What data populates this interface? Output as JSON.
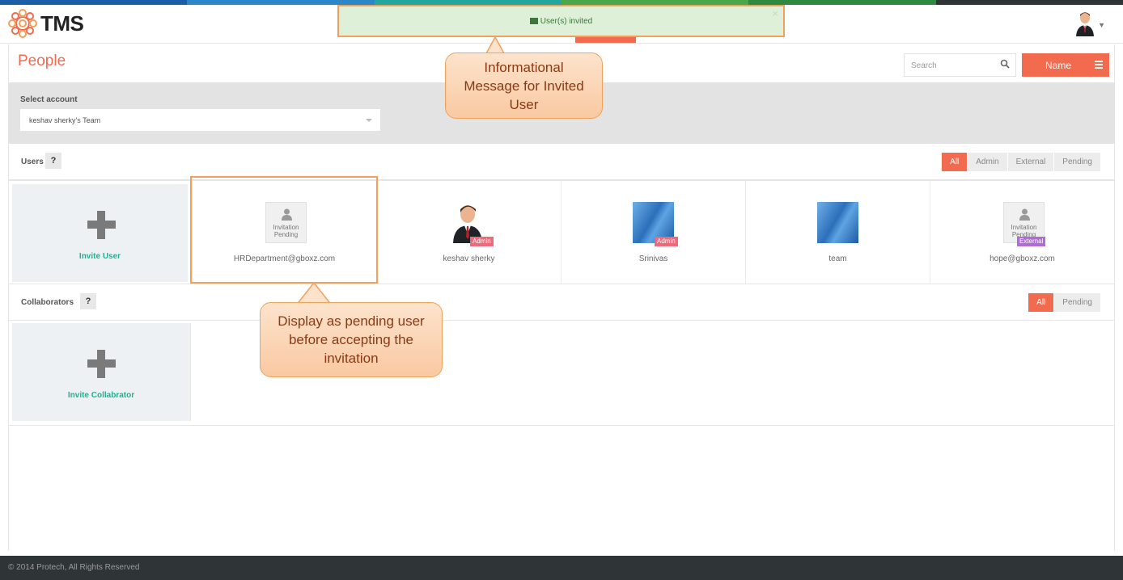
{
  "brand": {
    "logo_text": "TMS",
    "stripe_colors": [
      "#1b5fa8",
      "#2c87c9",
      "#24a6a0",
      "#4aa84a",
      "#f2a22e",
      "#2f3537"
    ]
  },
  "alert": {
    "message": "User(s) invited",
    "close_label": "×",
    "icon": "envelope-icon",
    "color": "#3c763d"
  },
  "page": {
    "title": "People",
    "search_placeholder": "Search",
    "sort_button_label": "Name"
  },
  "account": {
    "label": "Select account",
    "selected": "keshav sherky's Team"
  },
  "users": {
    "label": "Users",
    "help": "?",
    "filters": [
      "All",
      "Admin",
      "External",
      "Pending"
    ],
    "active_filter": "All",
    "invite_label": "Invite User",
    "cards": [
      {
        "name": "HRDepartment@gboxz.com",
        "avatar": "invitation-pending",
        "pending_text_1": "Invitation",
        "pending_text_2": "Pending",
        "badge": ""
      },
      {
        "name": "keshav sherky",
        "avatar": "person-avatar",
        "badge": "Admin"
      },
      {
        "name": "Srinivas",
        "avatar": "blue-avatar",
        "badge": "Admin"
      },
      {
        "name": "team",
        "avatar": "blue-avatar",
        "badge": ""
      },
      {
        "name": "hope@gboxz.com",
        "avatar": "invitation-pending",
        "pending_text_1": "Invitation",
        "pending_text_2": "Pending",
        "badge": "External"
      }
    ]
  },
  "collaborators": {
    "label": "Collaborators",
    "help": "?",
    "filters": [
      "All",
      "Pending"
    ],
    "active_filter": "All",
    "invite_label": "Invite Collabrator"
  },
  "annotations": {
    "top_callout_line1": "Informational",
    "top_callout_line2": "Message for Invited",
    "top_callout_line3": "User",
    "bottom_callout_line1": "Display as pending user",
    "bottom_callout_line2": "before accepting the",
    "bottom_callout_line3": "invitation"
  },
  "footer": {
    "text": "© 2014 Protech, All Rights Reserved"
  },
  "colors": {
    "accent": "#f26b4e",
    "teal": "#1ab394",
    "admin_badge": "#ee6a7a",
    "external_badge": "#b06bd6",
    "callout_border": "#f0a15a"
  }
}
